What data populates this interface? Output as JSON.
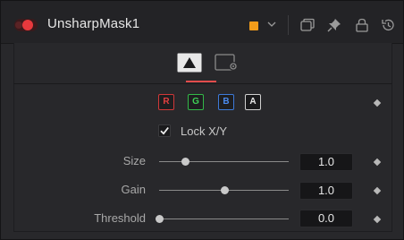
{
  "header": {
    "tool_name": "UnsharpMask1",
    "color_swatch": "#f29c1a",
    "icons": [
      "power-toggle-icon",
      "chevron-down-icon",
      "versions-icon",
      "pin-icon",
      "lock-icon",
      "reset-icon"
    ]
  },
  "tabs": [
    {
      "icon": "controls-tab-icon",
      "active": true
    },
    {
      "icon": "settings-tab-icon",
      "active": false
    }
  ],
  "channels": [
    {
      "label": "R",
      "color": "#e24040"
    },
    {
      "label": "G",
      "color": "#3fd056"
    },
    {
      "label": "B",
      "color": "#4b8cf0"
    },
    {
      "label": "A",
      "color": "#e8e8e8"
    }
  ],
  "lock": {
    "label": "Lock X/Y",
    "checked": true
  },
  "params": [
    {
      "label": "Size",
      "value": "1.0",
      "level": 0.2
    },
    {
      "label": "Gain",
      "value": "1.0",
      "level": 0.5
    },
    {
      "label": "Threshold",
      "value": "0.0",
      "level": 0.0
    }
  ],
  "accent_color": "#e24c4c"
}
